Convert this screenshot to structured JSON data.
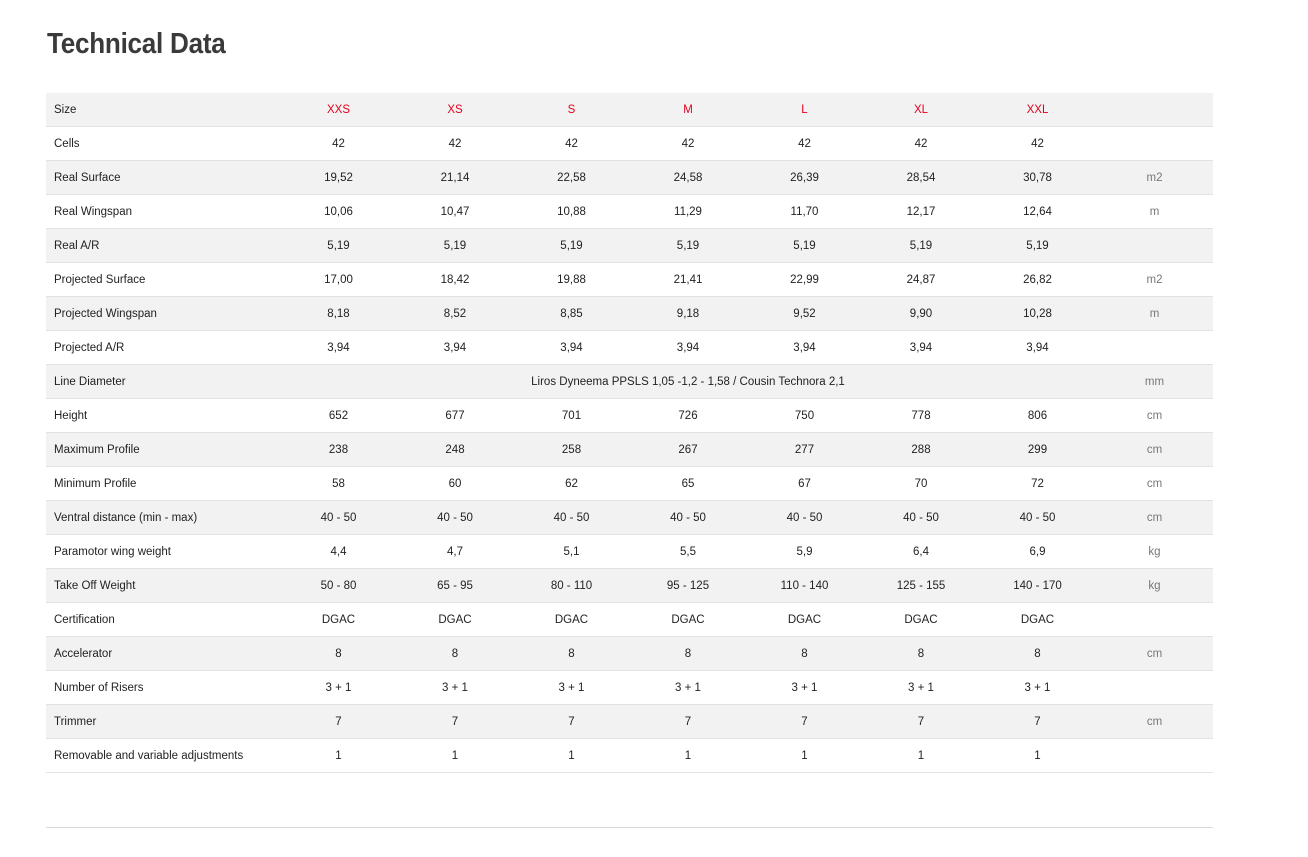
{
  "page": {
    "title": "Technical Data"
  },
  "colors": {
    "size_header": "#e3001b",
    "stripe": "#f2f2f2",
    "divider": "#e2e2e2"
  },
  "table": {
    "rows": [
      {
        "label": "Size",
        "values": [
          "XXS",
          "XS",
          "S",
          "M",
          "L",
          "XL",
          "XXL"
        ],
        "unit": "",
        "header": true
      },
      {
        "label": "Cells",
        "values": [
          "42",
          "42",
          "42",
          "42",
          "42",
          "42",
          "42"
        ],
        "unit": ""
      },
      {
        "label": "Real Surface",
        "values": [
          "19,52",
          "21,14",
          "22,58",
          "24,58",
          "26,39",
          "28,54",
          "30,78"
        ],
        "unit": "m2"
      },
      {
        "label": "Real Wingspan",
        "values": [
          "10,06",
          "10,47",
          "10,88",
          "11,29",
          "11,70",
          "12,17",
          "12,64"
        ],
        "unit": "m"
      },
      {
        "label": "Real A/R",
        "values": [
          "5,19",
          "5,19",
          "5,19",
          "5,19",
          "5,19",
          "5,19",
          "5,19"
        ],
        "unit": ""
      },
      {
        "label": "Projected Surface",
        "values": [
          "17,00",
          "18,42",
          "19,88",
          "21,41",
          "22,99",
          "24,87",
          "26,82"
        ],
        "unit": "m2"
      },
      {
        "label": "Projected Wingspan",
        "values": [
          "8,18",
          "8,52",
          "8,85",
          "9,18",
          "9,52",
          "9,90",
          "10,28"
        ],
        "unit": "m"
      },
      {
        "label": "Projected A/R",
        "values": [
          "3,94",
          "3,94",
          "3,94",
          "3,94",
          "3,94",
          "3,94",
          "3,94"
        ],
        "unit": ""
      },
      {
        "label": "Line Diameter",
        "merged": "Liros Dyneema PPSLS 1,05 -1,2 - 1,58 / Cousin Technora 2,1",
        "unit": "mm"
      },
      {
        "label": "Height",
        "values": [
          "652",
          "677",
          "701",
          "726",
          "750",
          "778",
          "806"
        ],
        "unit": "cm"
      },
      {
        "label": "Maximum Profile",
        "values": [
          "238",
          "248",
          "258",
          "267",
          "277",
          "288",
          "299"
        ],
        "unit": "cm"
      },
      {
        "label": "Minimum Profile",
        "values": [
          "58",
          "60",
          "62",
          "65",
          "67",
          "70",
          "72"
        ],
        "unit": "cm"
      },
      {
        "label": "Ventral distance (min - max)",
        "values": [
          "40 - 50",
          "40 - 50",
          "40 - 50",
          "40 - 50",
          "40 - 50",
          "40 - 50",
          "40 - 50"
        ],
        "unit": "cm"
      },
      {
        "label": "Paramotor wing weight",
        "values": [
          "4,4",
          "4,7",
          "5,1",
          "5,5",
          "5,9",
          "6,4",
          "6,9"
        ],
        "unit": "kg"
      },
      {
        "label": "Take Off Weight",
        "values": [
          "50 - 80",
          "65 - 95",
          "80 - 110",
          "95 - 125",
          "110 - 140",
          "125 - 155",
          "140 - 170"
        ],
        "unit": "kg"
      },
      {
        "label": "Certification",
        "values": [
          "DGAC",
          "DGAC",
          "DGAC",
          "DGAC",
          "DGAC",
          "DGAC",
          "DGAC"
        ],
        "unit": ""
      },
      {
        "label": "Accelerator",
        "values": [
          "8",
          "8",
          "8",
          "8",
          "8",
          "8",
          "8"
        ],
        "unit": "cm"
      },
      {
        "label": "Number of Risers",
        "values": [
          "3 + 1",
          "3 + 1",
          "3 + 1",
          "3 + 1",
          "3 + 1",
          "3 + 1",
          "3 + 1"
        ],
        "unit": ""
      },
      {
        "label": "Trimmer",
        "values": [
          "7",
          "7",
          "7",
          "7",
          "7",
          "7",
          "7"
        ],
        "unit": "cm"
      },
      {
        "label": "Removable and variable adjustments",
        "values": [
          "1",
          "1",
          "1",
          "1",
          "1",
          "1",
          "1"
        ],
        "unit": ""
      }
    ]
  }
}
